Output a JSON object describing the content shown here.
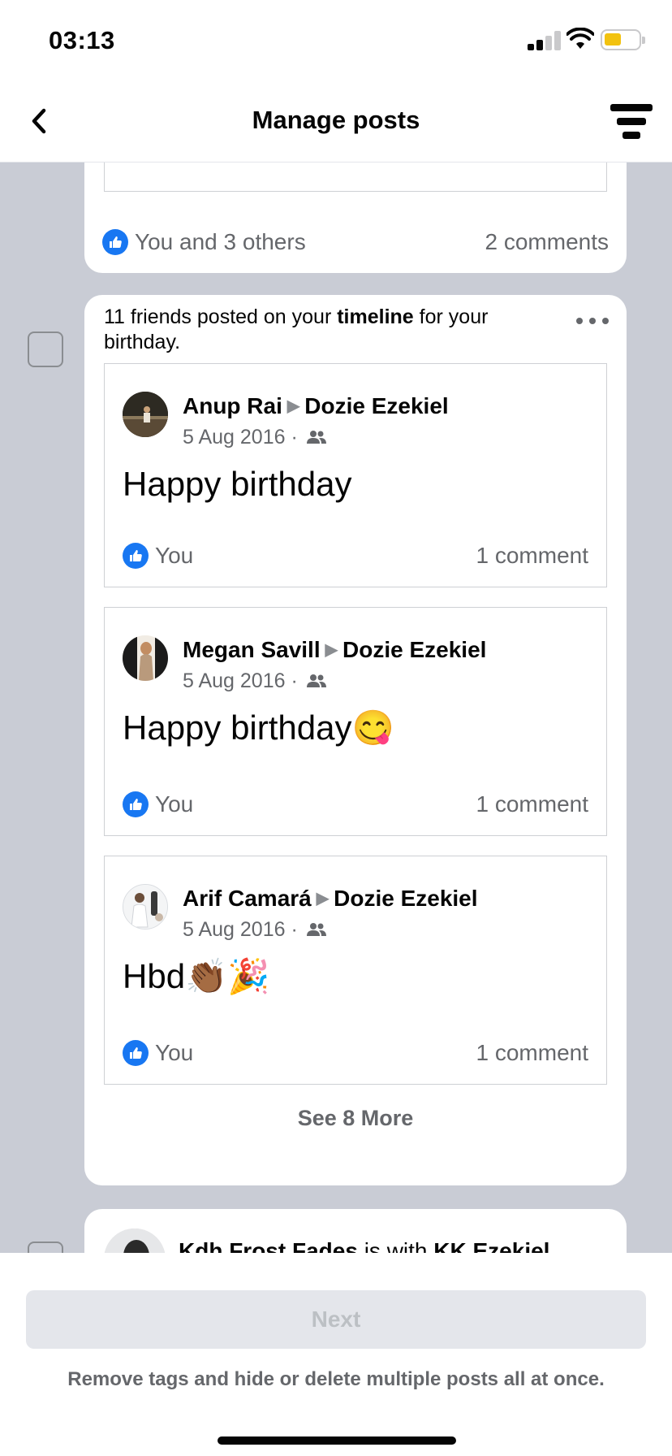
{
  "status_bar": {
    "time": "03:13",
    "icons": [
      "signal-icon",
      "wifi-icon",
      "battery-icon"
    ],
    "battery_color": "#f2c20f"
  },
  "nav": {
    "title": "Manage posts",
    "back_icon": "chevron-left-icon",
    "filter_icon": "filter-icon"
  },
  "previous_post": {
    "likes": "You and 3 others",
    "comments": "2 comments"
  },
  "birthday_group": {
    "header_prefix": "11 friends posted on your ",
    "header_bold": "timeline",
    "header_suffix": " for your birthday.",
    "posts": [
      {
        "author": "Anup Rai",
        "target": "Dozie Ezekiel",
        "date": "5 Aug 2016 ·",
        "text": "Happy birthday",
        "likes": "You",
        "comments": "1 comment"
      },
      {
        "author": "Megan Savill",
        "target": "Dozie Ezekiel",
        "date": "5 Aug 2016 ·",
        "text": "Happy birthday😋",
        "likes": "You",
        "comments": "1 comment"
      },
      {
        "author": "Arif Camará",
        "target": "Dozie Ezekiel",
        "date": "5 Aug 2016 ·",
        "text": "Hbd👏🏾🎉",
        "likes": "You",
        "comments": "1 comment"
      }
    ],
    "see_more": "See 8 More"
  },
  "next_post": {
    "author": "Kdh Frost Fades",
    "with_text": " is with ",
    "tagged": "KK Ezekiel"
  },
  "footer": {
    "next_label": "Next",
    "helper": "Remove tags and hide or delete multiple posts all at once."
  },
  "colors": {
    "accent": "#1877f2",
    "feed_background": "#c9ccd5",
    "secondary_text": "#65676b"
  }
}
